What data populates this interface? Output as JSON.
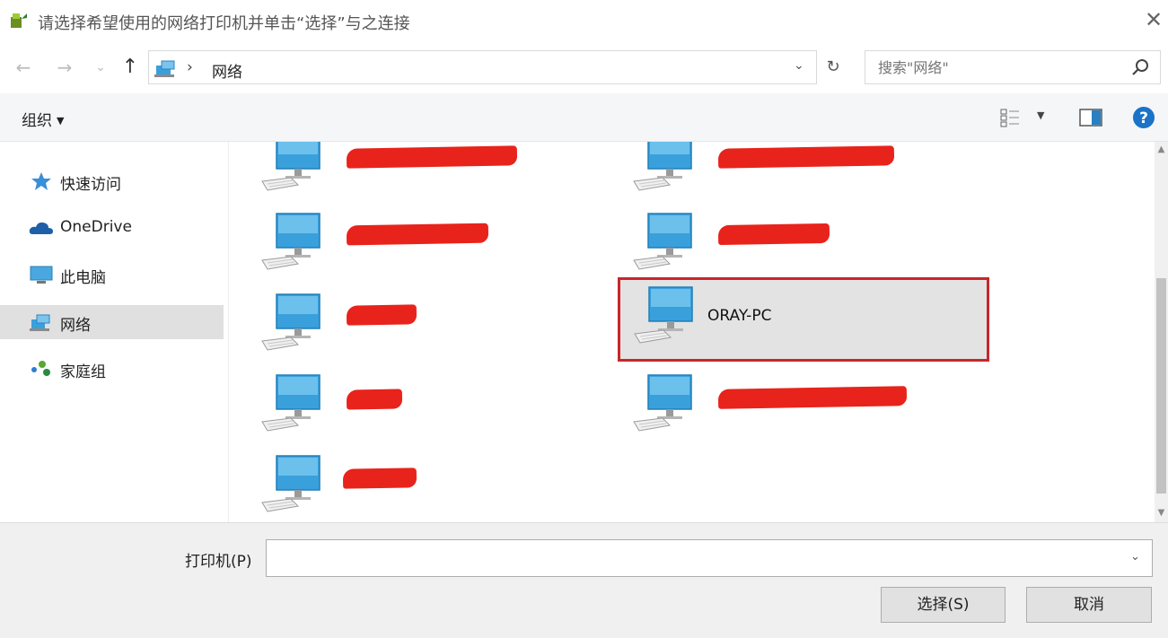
{
  "window": {
    "title": "请选择希望使用的网络打印机并单击“选择”与之连接",
    "close_glyph": "✕"
  },
  "nav": {
    "back_glyph": "←",
    "forward_glyph": "→",
    "recent_glyph": "⌄",
    "up_glyph": "↑"
  },
  "address": {
    "separator": "›",
    "crumb": "网络",
    "dropdown_glyph": "⌄",
    "refresh_glyph": "↻"
  },
  "search": {
    "placeholder": "搜索\"网络\""
  },
  "toolbar": {
    "organize_label": "组织",
    "organize_caret": "▼",
    "view_caret": "▼"
  },
  "sidebar": {
    "items": [
      {
        "label": "快速访问",
        "icon": "star-icon"
      },
      {
        "label": "OneDrive",
        "icon": "cloud-icon"
      },
      {
        "label": "此电脑",
        "icon": "pc-icon"
      },
      {
        "label": "网络",
        "icon": "network-icon",
        "selected": true
      },
      {
        "label": "家庭组",
        "icon": "homegroup-icon"
      }
    ]
  },
  "computers": [
    {
      "name": "",
      "redacted": true
    },
    {
      "name": "",
      "redacted": true
    },
    {
      "name": "",
      "redacted": true
    },
    {
      "name": "",
      "redacted": true
    },
    {
      "name": "",
      "redacted": true
    },
    {
      "name": "ORAY-PC",
      "redacted": false,
      "selected": true
    },
    {
      "name": "",
      "redacted": true
    },
    {
      "name": "",
      "redacted": true
    },
    {
      "name": "",
      "redacted": true
    }
  ],
  "footer": {
    "printer_label": "打印机(P)",
    "printer_value": "",
    "combo_glyph": "⌄",
    "select_button": "选择(S)",
    "cancel_button": "取消"
  },
  "scrollbar": {
    "up_glyph": "▲",
    "down_glyph": "▼"
  },
  "colors": {
    "highlight_border": "#c8262b",
    "redaction": "#e8231b",
    "monitor": "#3aa0dc",
    "help": "#1a73c8"
  }
}
